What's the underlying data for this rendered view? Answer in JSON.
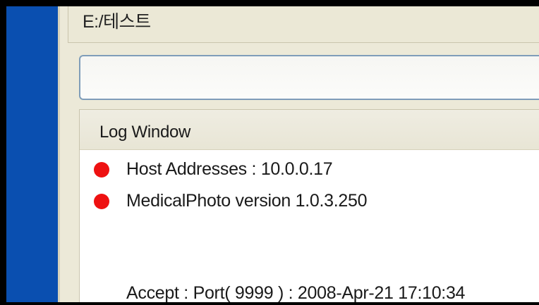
{
  "path_bar": {
    "value": "E:/테스트"
  },
  "command_input": {
    "value": ""
  },
  "log_window": {
    "title": "Log Window",
    "entries": [
      {
        "text": "Host Addresses : 10.0.0.17",
        "marker": "red-dot-icon"
      },
      {
        "text": "MedicalPhoto version 1.0.3.250",
        "marker": "red-dot-icon"
      },
      {
        "text": "Accept : Port( 9999 ) : 2008-Apr-21 17:10:34",
        "marker": ""
      }
    ]
  },
  "colors": {
    "sidebar_blue": "#0a4fb0",
    "marker_red": "#ee1111",
    "panel_beige": "#ece9d8",
    "input_border": "#7f9db9"
  }
}
